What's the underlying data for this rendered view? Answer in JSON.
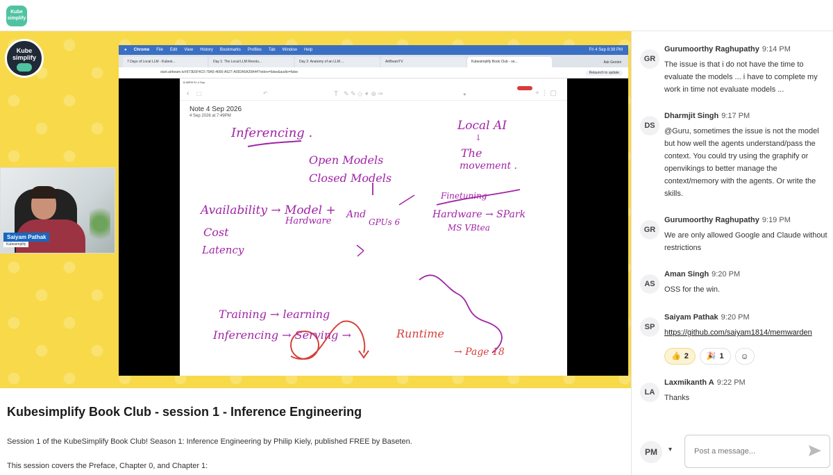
{
  "app": {
    "logo_text": "Kube simplify"
  },
  "stage": {
    "logo": {
      "line1": "Kube",
      "line2": "simplify"
    },
    "camera": {
      "name": "Saiyam Pathak",
      "org": "Kubesimplify"
    },
    "screen": {
      "menu": [
        "Chrome",
        "File",
        "Edit",
        "View",
        "History",
        "Bookmarks",
        "Profiles",
        "Tab",
        "Window",
        "Help"
      ],
      "clock": "Fri 4 Sep 8:39 PM",
      "tabs": [
        "7 Days of Local LLM - Kubesi...",
        "Day 1: The Local LLM Revolu...",
        "Day 2: Anatomy of an LLM ...",
        "AirBeamTV",
        "Kubesimplify Book Club - se..."
      ],
      "ask_gemini": "Ask Gemini",
      "url": "start.airbeam.tv/r973E6F4C0-79A5-4666-A627-A082A6A39A44?video=false&audio=false",
      "relaunch": "Relaunch to update",
      "ipad_status": "8:38PM  Fri 4 Sep",
      "note_title": "Note 4 Sep 2026",
      "note_date": "4 Sep 2026 at 7:49PM",
      "ink": {
        "inferencing": "Inferencing .",
        "local_ai": "Local AI",
        "the": "The",
        "movement": "movement .",
        "open_models": "Open Models",
        "closed_models": "Closed Models",
        "availability": "Availability → Model +",
        "hardware": "Hardware",
        "and": "And",
        "gpus": "GPUs 6",
        "freetuning": "Finetuning",
        "hardware_spark": "Hardware → SPark",
        "ms_vbtea": "MS VBtea",
        "cost": "Cost",
        "latency": "Latency",
        "training": "Training → learning",
        "inferencing2": "Inferencing → Serving →",
        "runtime": "Runtime",
        "page": "→ Page 18"
      }
    }
  },
  "session": {
    "title": "Kubesimplify Book Club - session 1 - Inference Engineering",
    "description": "Session 1 of the KubeSimplify Book Club! Season 1: Inference Engineering by Philip Kiely, published FREE by Baseten.",
    "description2": "This session covers the Preface, Chapter 0, and Chapter 1:"
  },
  "chat": {
    "messages": [
      {
        "initials": "GR",
        "name": "Gurumoorthy Raghupathy",
        "time": "9:14 PM",
        "text": "The issue is that i do not have the time to evaluate the models ... i have to complete my work in time not evaluate models ..."
      },
      {
        "initials": "DS",
        "name": "Dharmjit Singh",
        "time": "9:17 PM",
        "text": "@Guru, sometimes the issue is not the model but how well the agents understand/pass the context. You could try using the graphify or openvikings to better manage the context/memory with the agents. Or write the skills."
      },
      {
        "initials": "GR",
        "name": "Gurumoorthy Raghupathy",
        "time": "9:19 PM",
        "text": "We are only allowed Google and Claude without restrictions"
      },
      {
        "initials": "AS",
        "name": "Aman Singh",
        "time": "9:20 PM",
        "text": "OSS for the win."
      },
      {
        "initials": "SP",
        "name": "Saiyam Pathak",
        "time": "9:20 PM",
        "text": "https://github.com/saiyam1814/memwarden"
      },
      {
        "initials": "LA",
        "name": "Laxmikanth A",
        "time": "9:22 PM",
        "text": "Thanks"
      }
    ],
    "reactions": [
      {
        "emoji": "👍",
        "count": "2"
      },
      {
        "emoji": "🎉",
        "count": "1"
      }
    ],
    "add_reaction_icon": "☺",
    "composer": {
      "initials": "PM",
      "placeholder": "Post a message..."
    }
  }
}
